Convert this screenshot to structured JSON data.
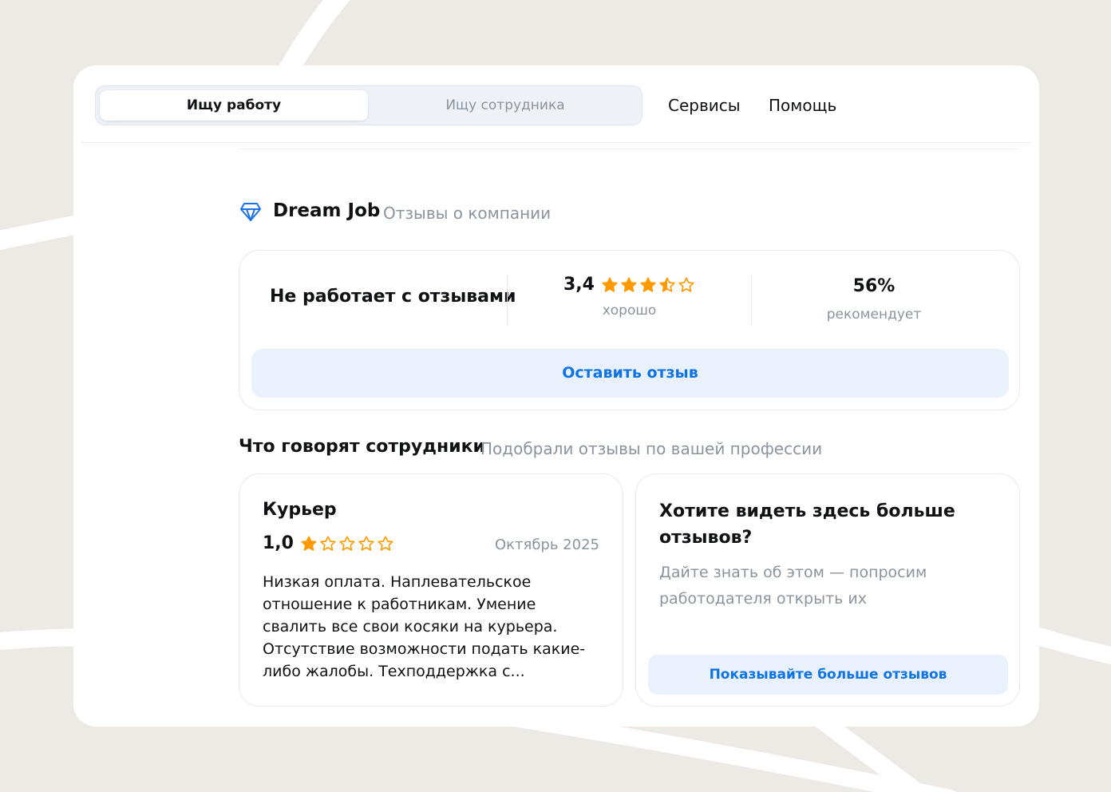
{
  "header": {
    "tabs": [
      {
        "label": "Ищу работу",
        "active": true
      },
      {
        "label": "Ищу сотрудника",
        "active": false
      }
    ],
    "nav": [
      {
        "label": "Сервисы"
      },
      {
        "label": "Помощь"
      }
    ]
  },
  "company": {
    "name": "Dream Job",
    "subtitle": "Отзывы о компании",
    "logo_icon": "diamond-logo-icon",
    "accent_color": "#0f73e6"
  },
  "summary": {
    "status": "Не работает с отзывами",
    "rating": "3,4",
    "rating_value": 3.4,
    "rating_label": "хорошо",
    "recommend": "56%",
    "recommend_label": "рекомендует",
    "leave_review_label": "Оставить отзыв"
  },
  "employees": {
    "title": "Что говорят сотрудники",
    "subtitle": "Подобрали отзывы по вашей профессии"
  },
  "review": {
    "job": "Курьер",
    "rating": "1,0",
    "rating_value": 1.0,
    "date": "Октябрь 2025",
    "text": "Низкая оплата. Наплевательское отношение к работникам. Умение свалить все свои косяки на курьера. Отсутствие возможности подать какие-либо жалобы. Техподдержка с..."
  },
  "more_reviews": {
    "title": "Хотите видеть здесь больше отзывов?",
    "text": "Дайте знать об этом — попросим работодателя открыть их",
    "button_label": "Показывайте больше отзывов"
  },
  "colors": {
    "star": "#ff9900",
    "background": "#edeae6",
    "button_bg": "#e8f1fc",
    "muted_text": "#8a949e"
  }
}
